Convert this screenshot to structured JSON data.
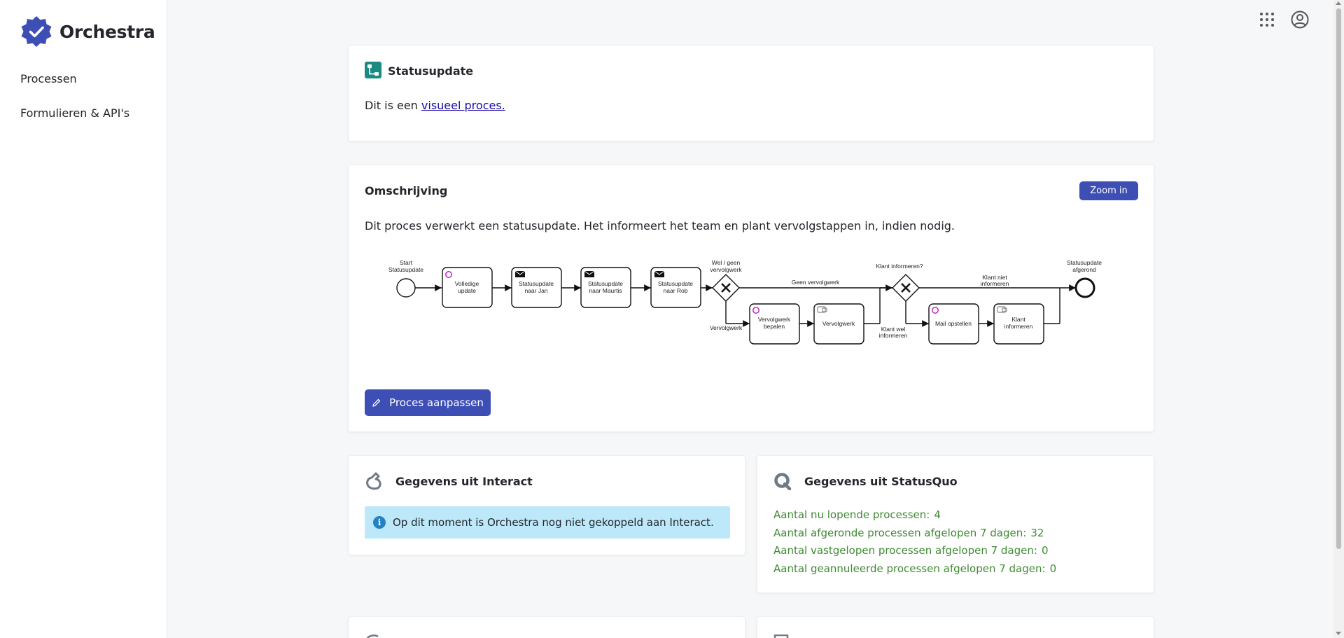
{
  "app": {
    "name": "Orchestra",
    "brand_color": "#3d4fb5"
  },
  "sidebar": {
    "items": [
      {
        "label": "Processen"
      },
      {
        "label": "Formulieren & API's"
      }
    ]
  },
  "topbar": {
    "icons": [
      "apps-grid-icon",
      "account-circle-icon"
    ]
  },
  "process_card": {
    "title": "Statusupdate",
    "text_prefix": "Dit is een ",
    "link_text": "visueel proces."
  },
  "description_card": {
    "title": "Omschrijving",
    "zoom_label": "Zoom in",
    "text": "Dit proces verwerkt een statusupdate. Het informeert het team en plant vervolgstappen in, indien nodig.",
    "edit_label": "Proces aanpassen",
    "diagram": {
      "start_label_1": "Start",
      "start_label_2": "Statusupdate",
      "task1_1": "Volledige",
      "task1_2": "update",
      "task2_1": "Statusupdate",
      "task2_2": "naar Jan",
      "task3_1": "Statusupdate",
      "task3_2": "naar Maurtis",
      "task4_1": "Statusupdate",
      "task4_2": "naar Rob",
      "gw1_1": "Wel / geen",
      "gw1_2": "vervolgwerk",
      "gw1_no": "Geen vervolgwerk",
      "gw1_yes": "Vervolgwerk",
      "task5_1": "Vervolgwerk",
      "task5_2": "bepalen",
      "task6": "Vervolgwerk",
      "gw2": "Klant informeren?",
      "gw2_no_1": "Klant niet",
      "gw2_no_2": "informeren",
      "gw2_yes_1": "Klant wel",
      "gw2_yes_2": "informeren",
      "task7": "Mail opstellen",
      "task8_1": "Klant",
      "task8_2": "informeren",
      "end_1": "Statusupdate",
      "end_2": "afgerond"
    }
  },
  "interact_card": {
    "title": "Gegevens uit Interact",
    "info": "Op dit moment is Orchestra nog niet gekoppeld aan Interact."
  },
  "statusquo_card": {
    "title": "Gegevens uit StatusQuo",
    "stats": [
      {
        "label": "Aantal nu lopende processen:",
        "value": "4"
      },
      {
        "label": "Aantal afgeronde processen afgelopen 7 dagen:",
        "value": "32"
      },
      {
        "label": "Aantal vastgelopen processen afgelopen 7 dagen:",
        "value": "0"
      },
      {
        "label": "Aantal geannuleerde processen afgelopen 7 dagen:",
        "value": "0"
      }
    ],
    "stat_color": "#3f8a33"
  }
}
